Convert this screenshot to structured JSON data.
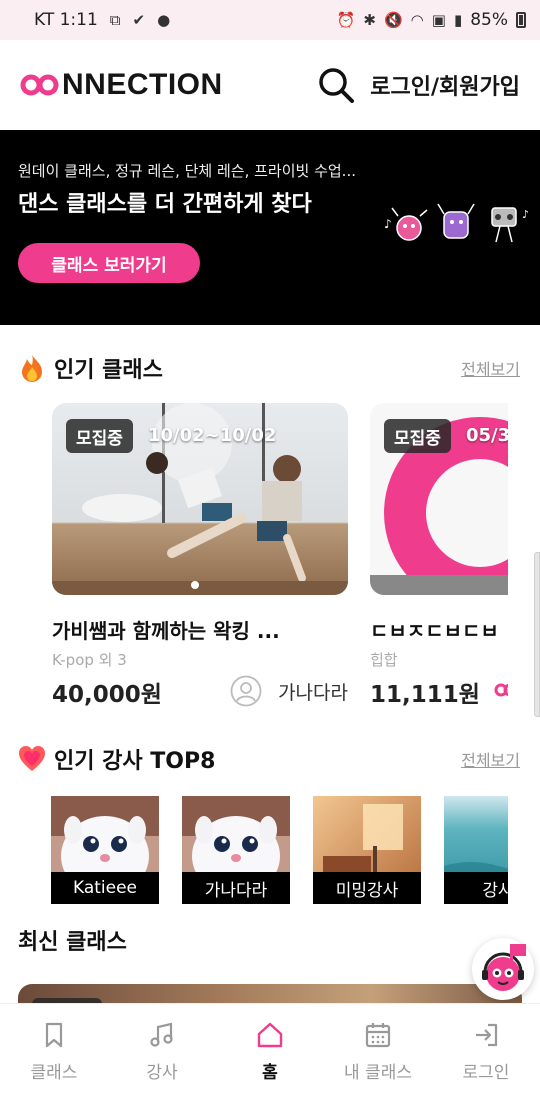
{
  "status_bar": {
    "carrier_time": "KT 1:11",
    "battery": "85%"
  },
  "header": {
    "logo_text": "NNECTION",
    "login_label": "로그인/회원가입"
  },
  "banner": {
    "subtitle": "원데이 클래스, 정규 레슨, 단체 레슨, 프라이빗 수업...",
    "title": "댄스 클래스를 더 간편하게 찾다",
    "button_label": "클래스 보러가기"
  },
  "popular_classes": {
    "title": "인기 클래스",
    "more_label": "전체보기",
    "cards": [
      {
        "badge": "모집중",
        "dates": "10/02~10/02",
        "title": "가비쌤과 함께하는 왁킹 ...",
        "genre": "K-pop 외 3",
        "price": "40,000원",
        "teacher": "가나다라"
      },
      {
        "badge": "모집중",
        "dates": "05/3",
        "title": "ㄷㅂㅈㄷㅂㄷㅂ",
        "genre": "힙합",
        "price": "11,111원",
        "teacher": ""
      }
    ]
  },
  "popular_teachers": {
    "title": "인기 강사 TOP8",
    "more_label": "전체보기",
    "items": [
      {
        "name": "Katieee"
      },
      {
        "name": "가나다라"
      },
      {
        "name": "미밍강사"
      },
      {
        "name": "강사"
      }
    ]
  },
  "latest_classes": {
    "title": "최신 클래스"
  },
  "bottom_nav": [
    {
      "label": "클래스",
      "icon": "bookmark-icon",
      "active": false
    },
    {
      "label": "강사",
      "icon": "music-note-icon",
      "active": false
    },
    {
      "label": "홈",
      "icon": "home-icon",
      "active": true
    },
    {
      "label": "내 클래스",
      "icon": "calendar-icon",
      "active": false
    },
    {
      "label": "로그인",
      "icon": "login-icon",
      "active": false
    }
  ],
  "colors": {
    "accent": "#f03c8c",
    "banner_bg": "#000000",
    "muted_text": "#999999"
  }
}
